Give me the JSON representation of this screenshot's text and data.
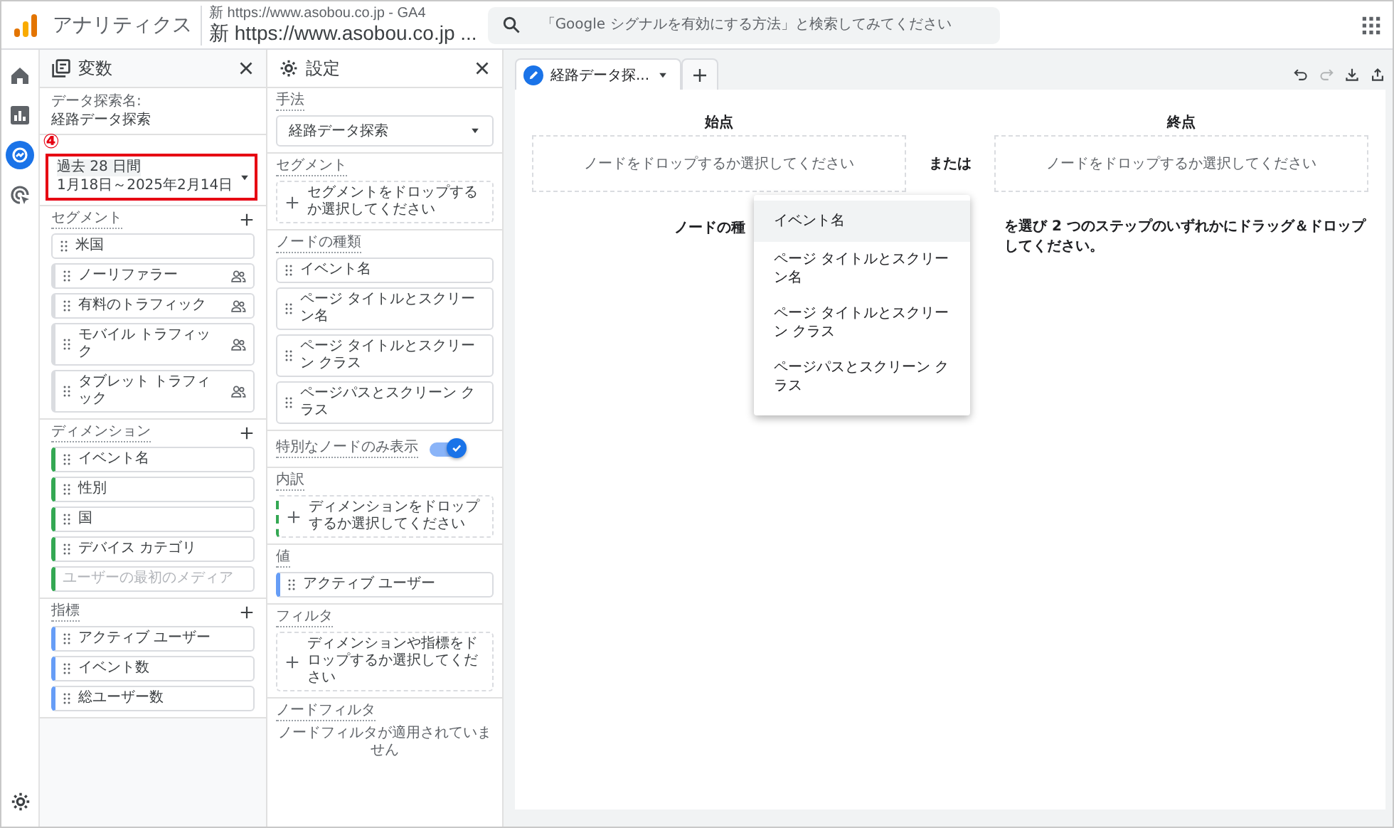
{
  "header": {
    "app_title": "アナリティクス",
    "account_path": "新 https://www.asobou.co.jp - GA4",
    "property_name": "新 https://www.asobou.co.jp ...",
    "search": {
      "placeholder": "「Google シグナルを有効にする方法」と検索してみてください"
    }
  },
  "nav_rail": {
    "items": [
      {
        "kind": "home",
        "selected": false
      },
      {
        "kind": "reports",
        "selected": false
      },
      {
        "kind": "explore",
        "selected": true
      },
      {
        "kind": "advertising",
        "selected": false
      }
    ]
  },
  "variables_panel": {
    "title": "変数",
    "exploration_name_label": "データ探索名:",
    "exploration_name": "経路データ探索",
    "annotation_marker": "④",
    "date_range": {
      "label": "過去 28 日間",
      "value": "1月18日～2025年2月14日",
      "highlighted": true
    },
    "segments": {
      "label": "セグメント",
      "items": [
        {
          "text": "米国",
          "kind": "plain"
        },
        {
          "text": "ノーリファラー",
          "kind": "audience"
        },
        {
          "text": "有料のトラフィック",
          "kind": "audience"
        },
        {
          "text": "モバイル トラフィック",
          "kind": "audience"
        },
        {
          "text": "タブレット トラフィック",
          "kind": "audience"
        }
      ]
    },
    "dimensions": {
      "label": "ディメンション",
      "items": [
        {
          "text": "イベント名",
          "disabled": false
        },
        {
          "text": "性別",
          "disabled": false
        },
        {
          "text": "国",
          "disabled": false
        },
        {
          "text": "デバイス カテゴリ",
          "disabled": false
        },
        {
          "text": "ユーザーの最初のメディア",
          "disabled": true
        }
      ]
    },
    "metrics": {
      "label": "指標",
      "items": [
        {
          "text": "アクティブ ユーザー"
        },
        {
          "text": "イベント数"
        },
        {
          "text": "総ユーザー数"
        }
      ]
    }
  },
  "settings_panel": {
    "title": "設定",
    "technique": {
      "label": "手法",
      "value": "経路データ探索"
    },
    "segment_comparison": {
      "label": "セグメント",
      "drop_hint": "セグメントをドロップするか選択してください"
    },
    "node_types": {
      "label": "ノードの種類",
      "items": [
        "イベント名",
        "ページ タイトルとスクリーン名",
        "ページ タイトルとスクリーン クラス",
        "ページパスとスクリーン クラス"
      ]
    },
    "unique_nodes_toggle": {
      "label": "特別なノードのみ表示",
      "on": true
    },
    "breakdown": {
      "label": "内訳",
      "drop_hint": "ディメンションをドロップするか選択してください"
    },
    "values": {
      "label": "値",
      "items": [
        "アクティブ ユーザー"
      ]
    },
    "filters": {
      "label": "フィルタ",
      "drop_hint": "ディメンションや指標をドロップするか選択してください"
    },
    "node_filters": {
      "label": "ノードフィルタ",
      "empty_text": "ノードフィルタが適用されていません"
    }
  },
  "canvas": {
    "tabs": [
      {
        "label": "経路データ探...",
        "selected": true
      }
    ],
    "toolbar": [
      {
        "kind": "undo",
        "disabled": false
      },
      {
        "kind": "redo",
        "disabled": true
      },
      {
        "kind": "download",
        "disabled": false
      },
      {
        "kind": "share",
        "disabled": false
      }
    ],
    "starting_point": {
      "label": "始点",
      "hint": "ノードをドロップするか選択してください"
    },
    "separator": "または",
    "ending_point": {
      "label": "終点",
      "hint": "ノードをドロップするか選択してください"
    },
    "instruction_left": "ノードの種",
    "instruction_right": "を選び 2 つのステップのいずれかにドラッグ＆ドロップしてください。",
    "node_menu": {
      "items": [
        {
          "label": "イベント名",
          "selected": true
        },
        {
          "label": "ページ タイトルとスクリーン名",
          "selected": false
        },
        {
          "label": "ページ タイトルとスクリーン クラス",
          "selected": false
        },
        {
          "label": "ページパスとスクリーン クラス",
          "selected": false
        }
      ]
    }
  }
}
